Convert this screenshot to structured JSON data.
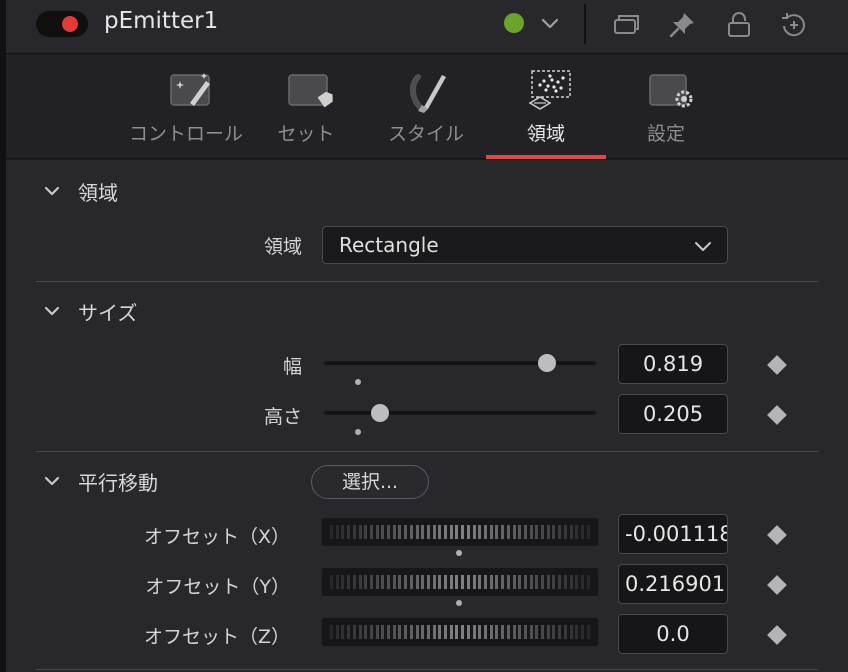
{
  "header": {
    "node_name": "pEmitter1",
    "toggle_color": "#e53935",
    "status_color": "#6aa52a",
    "icons": [
      "chevron-down-icon",
      "window-icon",
      "pin-icon",
      "lock-icon",
      "reset-icon"
    ]
  },
  "tabs": [
    {
      "label": "コントロール",
      "icon": "controls-icon",
      "active": false
    },
    {
      "label": "セット",
      "icon": "tag-icon",
      "active": false
    },
    {
      "label": "スタイル",
      "icon": "brush-icon",
      "active": false
    },
    {
      "label": "領域",
      "icon": "region-icon",
      "active": true
    },
    {
      "label": "設定",
      "icon": "settings-icon",
      "active": false
    }
  ],
  "accent_color": "#e8453c",
  "sections": {
    "region": {
      "title": "領域",
      "field_label": "領域",
      "value": "Rectangle"
    },
    "size": {
      "title": "サイズ",
      "width_label": "幅",
      "width_value": "0.819",
      "width_level": 0.819,
      "height_label": "高さ",
      "height_value": "0.205",
      "height_level": 0.205
    },
    "translate": {
      "title": "平行移動",
      "select_button": "選択...",
      "offset_x_label": "オフセット（X）",
      "offset_x_value": "-0.001118",
      "offset_y_label": "オフセット（Y）",
      "offset_y_value": "0.216901",
      "offset_z_label": "オフセット（Z）",
      "offset_z_value": "0.0"
    }
  }
}
